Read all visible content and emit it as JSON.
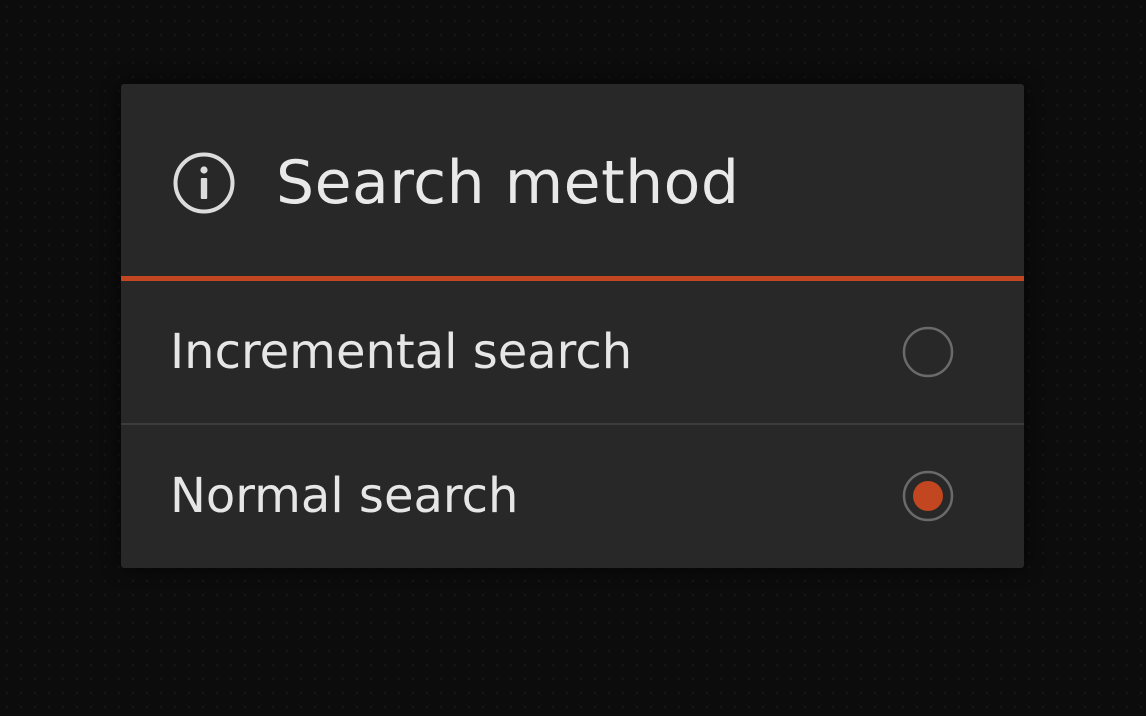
{
  "dialog": {
    "title": "Search method",
    "title_icon": "info-icon",
    "accent_color": "#c2461f",
    "options": [
      {
        "label": "Incremental search",
        "selected": false
      },
      {
        "label": "Normal search",
        "selected": true
      }
    ]
  }
}
